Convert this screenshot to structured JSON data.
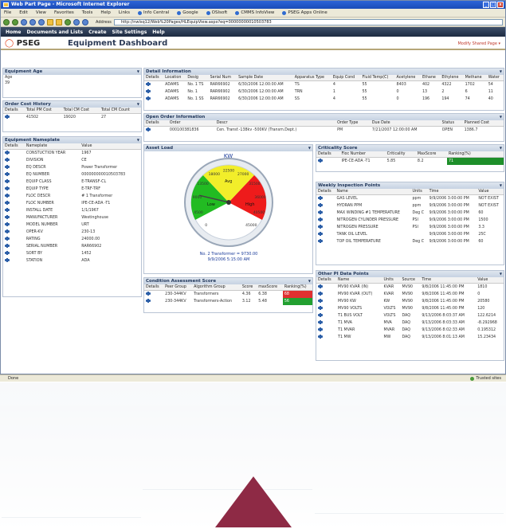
{
  "browser": {
    "title": "Web Part Page - Microsoft Internet Explorer",
    "menu": [
      "File",
      "Edit",
      "View",
      "Favorites",
      "Tools",
      "Help"
    ],
    "links": [
      "Links",
      "Info Central",
      "Google",
      "OSIsoft",
      "CMMS InfoView",
      "PSEG Apps Online"
    ],
    "address_label": "Address",
    "address": "http://nwlsq12/Web%20Pages/HLEquipView.aspx?eq=00000000010503783"
  },
  "nav": {
    "items": [
      "Home",
      "Documents and Lists",
      "Create",
      "Site Settings",
      "Help"
    ]
  },
  "header": {
    "logo": "PSEG",
    "title": "Equipment Dashboard",
    "modify": "Modify Shared Page ▾"
  },
  "age": {
    "title": "Equipment Age",
    "label": "Age",
    "value": "39"
  },
  "cost": {
    "title": "Order Cost History",
    "headers": [
      "Details",
      "Total PM Cost",
      "Total CM Cost",
      "Total CM Count"
    ],
    "row": [
      "41502",
      "19020",
      "27"
    ]
  },
  "nameplate": {
    "title": "Equipment Nameplate",
    "headers": [
      "Details",
      "Nameplate",
      "Value"
    ],
    "rows": [
      [
        "CONSTUCTION YEAR",
        "1967"
      ],
      [
        "DIVISION",
        "CE"
      ],
      [
        "EQ DESCR",
        "Power Transformer"
      ],
      [
        "EQ NUMBER",
        "000000000010503783"
      ],
      [
        "EQUIP CLASS",
        "E-TRANSF-CL"
      ],
      [
        "EQUIP TYPE",
        "E-TRF-TRF"
      ],
      [
        "FLOC DESCR",
        "# 1 Transformer"
      ],
      [
        "FLOC NUMBER",
        "IPE-CE-ADA -T1"
      ],
      [
        "INSTALL DATE",
        "1/1/1967"
      ],
      [
        "MANUFACTURER",
        "Westinghouse"
      ],
      [
        "MODEL NUMBER",
        "URT"
      ],
      [
        "OPER-KV",
        "230-13"
      ],
      [
        "RATING",
        "24000.00"
      ],
      [
        "SERIAL NUMBER",
        "RAR66902"
      ],
      [
        "SORT BY",
        "1452"
      ],
      [
        "STATION",
        "ADA"
      ]
    ]
  },
  "detail": {
    "title": "Detail Information",
    "headers": [
      "Details",
      "Location",
      "Desig",
      "Serial Num",
      "Sample Date",
      "Apparatus Type",
      "Equip Cond",
      "Fluid Temp(C)",
      "Acetylene",
      "Ethane",
      "Ethylene",
      "Methane",
      "Water"
    ],
    "rows": [
      [
        "ADAMS",
        "No. 1 TS",
        "RAR66902",
        "6/30/2006 12:00:00 AM",
        "TS",
        "4",
        "55",
        "8403",
        "402",
        "4322",
        "1702",
        "54"
      ],
      [
        "ADAMS",
        "No. 1",
        "RAR66902",
        "6/30/2006 12:00:00 AM",
        "TRN",
        "1",
        "55",
        "0",
        "13",
        "2",
        "6",
        "11"
      ],
      [
        "ADAMS",
        "No. 1 SS",
        "RAR66902",
        "6/30/2006 12:00:00 AM",
        "SS",
        "4",
        "55",
        "0",
        "196",
        "194",
        "74",
        "40"
      ]
    ]
  },
  "open_order": {
    "title": "Open Order Information",
    "headers": [
      "Details",
      "Order",
      "Descr",
      "Order Type",
      "Due Date",
      "Status",
      "Planned Cost"
    ],
    "row": [
      "000100381836",
      "Cen. Transf.-138kv -500KV (Transm.Dept.)",
      "PM",
      "7/21/2007 12:00:00 AM",
      "OPEN",
      "1386.7"
    ]
  },
  "asset_load": {
    "title": "Asset Load",
    "unit": "KW",
    "gauge_labels": [
      "0",
      "4500",
      "9000",
      "13500",
      "18000",
      "22500",
      "27000",
      "31500",
      "36000",
      "40500",
      "45000"
    ],
    "zones": [
      "Low",
      "Avg",
      "High"
    ],
    "readout": "No. 2 Transformer = 9730.00",
    "time": "9/9/2006 5:15:00 AM",
    "value": 9730
  },
  "criticality": {
    "title": "Criticality Score",
    "headers": [
      "Details",
      "Floc Number",
      "Criticality",
      "MaxScore",
      "Ranking(%)"
    ],
    "row": [
      "IPE-CE-ADA -T1",
      "5.85",
      "8.2",
      "71"
    ],
    "ranking": 71,
    "bar_color": "#1e8f2a"
  },
  "inspection": {
    "title": "Weekly Inspection Points",
    "headers": [
      "Details",
      "Name",
      "Units",
      "Time",
      "Value"
    ],
    "rows": [
      [
        "GAS LEVEL",
        "ppm",
        "9/9/2006 3:00:00 PM",
        "NOT EXIST"
      ],
      [
        "HYDRAN PPM",
        "ppm",
        "9/9/2006 3:00:00 PM",
        "NOT EXIST"
      ],
      [
        "MAX WINDING #1 TEMPERATURE",
        "Deg C",
        "9/9/2006 3:00:00 PM",
        "60"
      ],
      [
        "NITROGEN CYLINDER PRESSURE",
        "PSI",
        "9/9/2006 3:00:00 PM",
        "1500"
      ],
      [
        "NITROGEN PRESSURE",
        "PSI",
        "9/9/2006 3:00:00 PM",
        "3.3"
      ],
      [
        "TANK OIL LEVEL",
        "",
        "9/9/2006 3:00:00 PM",
        "25C"
      ],
      [
        "TOP OIL TEMPERATURE",
        "Deg C",
        "9/9/2006 3:00:00 PM",
        "60"
      ]
    ]
  },
  "condition": {
    "title": "Condition Assessment Score",
    "headers": [
      "Details",
      "Peer Group",
      "Algorithm Group",
      "Score",
      "maxScore",
      "Ranking(%)"
    ],
    "rows": [
      [
        "230-344KV",
        "Transformers",
        "4.36",
        "6.38",
        "68"
      ],
      [
        "230-344KV",
        "Transformers-Action",
        "3.12",
        "5.48",
        "56"
      ]
    ],
    "colors": [
      "#e03030",
      "#22a030"
    ]
  },
  "pi": {
    "title": "Other PI Data Points",
    "headers": [
      "Details",
      "Name",
      "Units",
      "Source",
      "Time",
      "Value"
    ],
    "rows": [
      [
        "MV90 KVAR (IN)",
        "KVAR",
        "MV90",
        "9/8/2006 11:45:00 PM",
        "1810"
      ],
      [
        "MV90 KVAR (OUT)",
        "KVAR",
        "MV90",
        "9/8/2006 11:45:00 PM",
        "0"
      ],
      [
        "MV90 KW",
        "KW",
        "MV90",
        "9/8/2006 11:45:00 PM",
        "20580"
      ],
      [
        "MV90 VOLTS",
        "VOLTS",
        "MV90",
        "9/8/2006 11:45:00 PM",
        "120"
      ],
      [
        "T1 BUS VOLT",
        "VOLTS",
        "DAQ",
        "9/13/2006 8:03:37 AM",
        "122.6214"
      ],
      [
        "T1 MVA",
        "MVA",
        "DAQ",
        "9/13/2006 8:03:33 AM",
        "-8.292968"
      ],
      [
        "T1 MVAR",
        "MVAR",
        "DAQ",
        "9/13/2006 8:02:33 AM",
        "0.195312"
      ],
      [
        "T1 MW",
        "MW",
        "DAQ",
        "9/13/2006 8:01:13 AM",
        "15.23434"
      ]
    ]
  },
  "statusbar": {
    "text": "Done",
    "zone": "Trusted sites"
  }
}
